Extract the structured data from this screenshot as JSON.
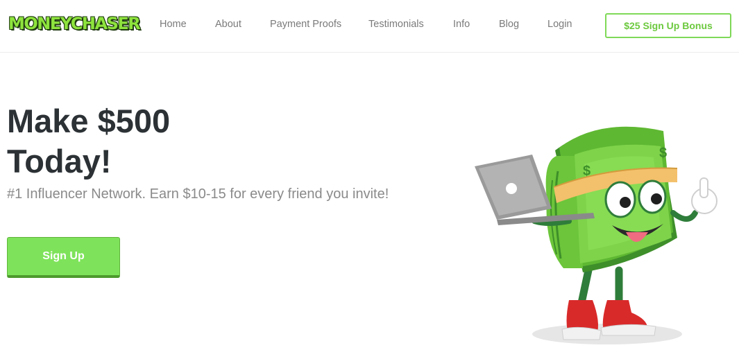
{
  "brand": {
    "logo_text": "MONEYCHASER"
  },
  "nav": {
    "items": [
      {
        "label": "Home"
      },
      {
        "label": "About"
      },
      {
        "label": "Payment Proofs"
      },
      {
        "label": "Testimonials"
      },
      {
        "label": "Info"
      },
      {
        "label": "Blog"
      },
      {
        "label": "Login"
      }
    ],
    "cta_label": "$25 Sign Up Bonus"
  },
  "hero": {
    "title_line1": "Make $500",
    "title_line2": "Today!",
    "subtitle": "#1 Influencer Network. Earn $10-15 for every friend you invite!",
    "button_label": "Sign Up"
  },
  "mascot": {
    "icon": "money-stack-mascot-with-laptop"
  },
  "colors": {
    "accent": "#7ed957",
    "button_fill": "#7ee35a",
    "title": "#2b3135",
    "subtitle": "#8a8a8a",
    "nav_text": "#7a7a7a"
  }
}
